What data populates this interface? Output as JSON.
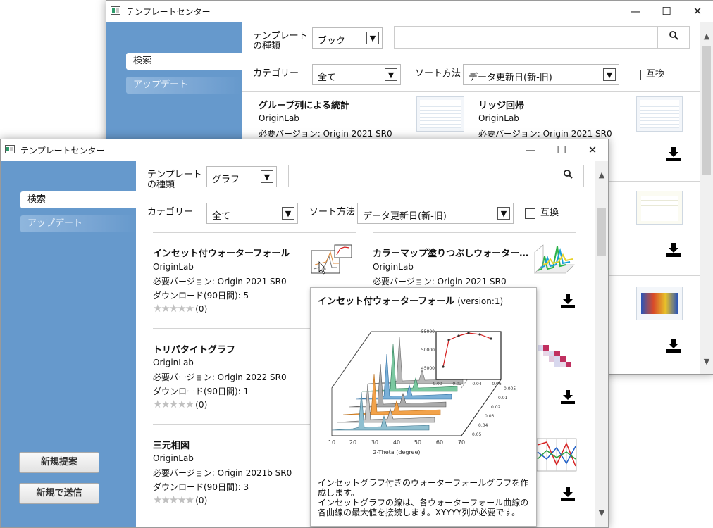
{
  "back_window": {
    "title": "テンプレートセンター",
    "nav": {
      "search": "検索",
      "update": "アップデート"
    },
    "filters": {
      "template_type_label": "テンプレートの種類",
      "template_type_value": "ブック",
      "category_label": "カテゴリー",
      "category_value": "全て",
      "sort_label": "ソート方法",
      "sort_value": "データ更新日(新-旧)",
      "compat_label": "互換"
    },
    "items": [
      {
        "title": "グループ列による統計",
        "author": "OriginLab",
        "version": "必要バージョン: Origin 2021 SR0"
      },
      {
        "title": "リッジ回帰",
        "author": "OriginLab",
        "version": "必要バージョン: Origin 2021 SR0"
      }
    ]
  },
  "front_window": {
    "title": "テンプレートセンター",
    "nav": {
      "search": "検索",
      "update": "アップデート"
    },
    "buttons": {
      "propose": "新規提案",
      "submit": "新規で送信"
    },
    "filters": {
      "template_type_label": "テンプレートの種類",
      "template_type_value": "グラフ",
      "category_label": "カテゴリー",
      "category_value": "全て",
      "sort_label": "ソート方法",
      "sort_value": "データ更新日(新-旧)",
      "compat_label": "互換"
    },
    "items": [
      {
        "title": "インセット付ウォーターフォール",
        "author": "OriginLab",
        "version": "必要バージョン: Origin 2021 SR0",
        "downloads": "ダウンロード(90日間): 5",
        "rating_count": "(0)"
      },
      {
        "title": "カラーマップ塗りつぶしウォーター…",
        "author": "OriginLab",
        "version": "必要バージョン: Origin 2021 SR0"
      },
      {
        "title": "トリパタイトグラフ",
        "author": "OriginLab",
        "version": "必要バージョン: Origin 2022 SR0",
        "downloads": "ダウンロード(90日間): 1",
        "rating_count": "(0)"
      },
      {
        "title": "三元相図",
        "author": "OriginLab",
        "version": "必要バージョン: Origin 2021b SR0",
        "downloads": "ダウンロード(90日間): 3",
        "rating_count": "(0)"
      }
    ],
    "tooltip": {
      "title": "インセット付ウォーターフォール",
      "version": "(version:1)",
      "description_1": "インセットグラフ付きのウォーターフォールグラフを作成します。",
      "description_2": "インセットグラフの線は、各ウォーターフォール曲線の各曲線の最大値を接続します。XYYYY列が必要です。",
      "preview": {
        "x_ticks": [
          "10",
          "20",
          "30",
          "40",
          "50",
          "60",
          "70"
        ],
        "x_label": "2-Theta (degree)",
        "z_ticks": [
          "0.005",
          "0.01",
          "0.02",
          "0.03",
          "0.04",
          "0.05"
        ],
        "inset_y_ticks": [
          "55000",
          "50000",
          "45000"
        ],
        "inset_x_ticks": [
          "0.00",
          "0.02",
          "0.04",
          "0.06"
        ]
      }
    }
  },
  "icons": {
    "search": "search-icon",
    "download": "download-icon",
    "close": "close-icon",
    "maximize": "maximize-icon",
    "minimize": "minimize-icon"
  },
  "colors": {
    "sidebar": "#6699cc",
    "accent_red": "#d62020"
  }
}
